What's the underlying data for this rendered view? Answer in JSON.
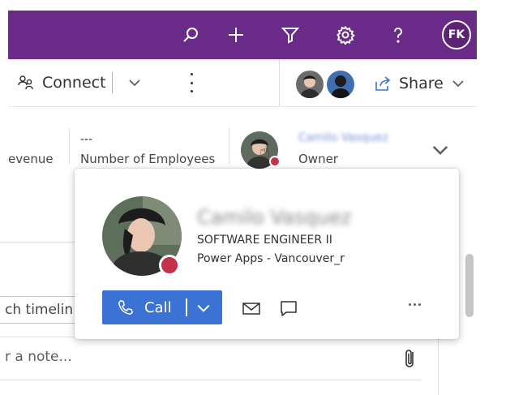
{
  "topbar": {
    "background": "#6a2a87",
    "icons": [
      "search-icon",
      "add-icon",
      "filter-icon",
      "settings-gear-icon",
      "help-icon"
    ],
    "user_initials": "FK"
  },
  "commandbar": {
    "connect_label": "Connect",
    "share_label": "Share"
  },
  "header_fields": {
    "revenue_label": "evenue",
    "employees_value": "---",
    "employees_label": "Number of Employees",
    "owner_name": "Camilo Vasquez",
    "owner_label": "Owner"
  },
  "contact_card": {
    "name": "Camilo Vasquez",
    "job_title": "SOFTWARE ENGINEER II",
    "company": "Power Apps - Vancouver_r",
    "call_label": "Call",
    "presence_color": "#c4314b",
    "accent": "#3d72d5"
  },
  "timeline": {
    "search_placeholder": "ch timelin",
    "note_placeholder": "r a note..."
  }
}
